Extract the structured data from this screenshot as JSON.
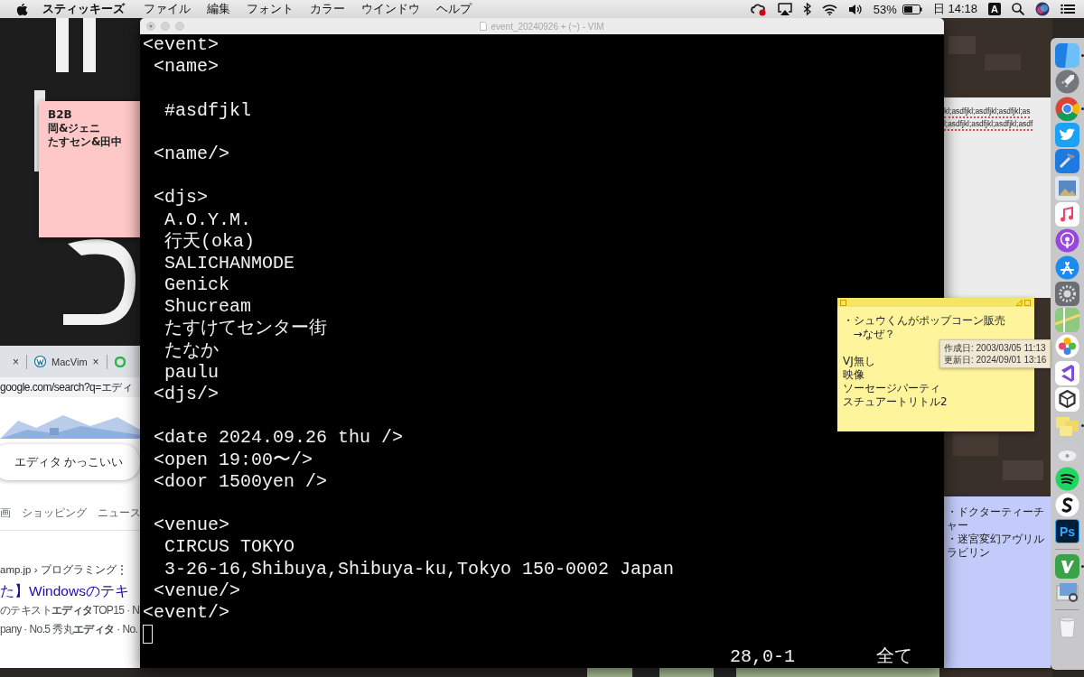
{
  "menu_bar": {
    "app_name": "スティッキーズ",
    "menus": [
      "ファイル",
      "編集",
      "フォント",
      "カラー",
      "ウインドウ",
      "ヘルプ"
    ],
    "battery": "53%",
    "clock": "日 14:18",
    "input_source": "A"
  },
  "stickies": [
    {
      "color": "#ffc8c8",
      "active": false,
      "lines": [
        {
          "text": "B2B"
        },
        {
          "text": "岡&ジェニ"
        },
        {
          "text": "たすセン&田中"
        }
      ]
    },
    {
      "color": "#fef49c",
      "active": true,
      "lines": [
        {
          "text": "・シュウくんがポップコーン販売"
        },
        {
          "text": "   →なぜ？"
        },
        {
          "kind": "blank"
        },
        {
          "text": "VJ無し"
        },
        {
          "text": "映像"
        },
        {
          "text": "ソーセージパーティ"
        },
        {
          "text": "スチュアートリトル2"
        }
      ]
    },
    {
      "color": "#c3cbfa",
      "active": false,
      "lines": [
        {
          "text": "・ドクターティーチャー"
        },
        {
          "text": "・迷宮変幻アヴリルラビリン"
        }
      ]
    }
  ],
  "sticky_tooltip": [
    "作成日: 2003/03/05 11:13",
    "更新日: 2024/09/01 13:16"
  ],
  "text_window": {
    "lines": [
      "kl;asdfjkl;asdfjkl;asdfjkl;as",
      "l;asdfjkl;asdfjkl;asdfjkl;asdf"
    ]
  },
  "browser": {
    "tabs": [
      {
        "kind": "close-only",
        "close": "×"
      },
      {
        "kind": "page",
        "title": "MacVim",
        "close": "×"
      },
      {
        "kind": "icon-only"
      }
    ],
    "address": "google.com/search?q=エディ",
    "query": "エディタ かっこいい",
    "search_tabs": [
      "画",
      "ショッピング",
      "ニュース"
    ],
    "result": {
      "breadcrumb": "amp.jp › プログラミング",
      "menu": "⋮",
      "title": "た】Windowsのテキ",
      "snippet": [
        "のテキスト**エディタ**TOP15 · N",
        "pany · No.5 秀丸**エディタ** · No."
      ]
    }
  },
  "vim": {
    "title": "event_20240926 + (~) - VIM",
    "lines": [
      {
        "text": "<event>"
      },
      {
        "text": " <name>"
      },
      {
        "kind": "blank"
      },
      {
        "text": "  #asdfjkl"
      },
      {
        "kind": "blank"
      },
      {
        "text": " <name/>"
      },
      {
        "kind": "blank"
      },
      {
        "text": " <djs>"
      },
      {
        "text": "  A.O.Y.M."
      },
      {
        "text": "  行天(oka)"
      },
      {
        "text": "  SALICHANMODE"
      },
      {
        "text": "  Genick"
      },
      {
        "text": "  Shucream"
      },
      {
        "text": "  たすけてセンター街"
      },
      {
        "text": "  たなか"
      },
      {
        "text": "  paulu"
      },
      {
        "text": " <djs/>"
      },
      {
        "kind": "blank"
      },
      {
        "text": " <date 2024.09.26 thu />"
      },
      {
        "text": " <open 19:00〜/>"
      },
      {
        "text": " <door 1500yen />"
      },
      {
        "kind": "blank"
      },
      {
        "text": " <venue>"
      },
      {
        "text": "  CIRCUS TOKYO"
      },
      {
        "text": "  3-26-16,Shibuya,Shibuya-ku,Tokyo 150-0002 Japan"
      },
      {
        "text": " <venue/>"
      },
      {
        "text": "<event/>"
      }
    ],
    "position": "28,0-1",
    "scroll": "全て"
  },
  "dock": {
    "items": [
      {
        "kind": "app",
        "running": true
      },
      {
        "kind": "app",
        "running": false
      },
      {
        "kind": "app",
        "running": true
      },
      {
        "kind": "app",
        "running": false
      },
      {
        "kind": "app",
        "running": false
      },
      {
        "kind": "app",
        "running": false
      },
      {
        "kind": "app",
        "running": false
      },
      {
        "kind": "app",
        "running": false
      },
      {
        "kind": "app",
        "running": false
      },
      {
        "kind": "app",
        "running": false
      },
      {
        "kind": "app",
        "running": false
      },
      {
        "kind": "app",
        "running": false
      },
      {
        "kind": "app",
        "running": false
      },
      {
        "kind": "app",
        "running": false
      },
      {
        "kind": "app",
        "running": true
      },
      {
        "kind": "app",
        "running": false
      },
      {
        "kind": "app",
        "running": false
      },
      {
        "kind": "app",
        "running": false
      },
      {
        "kind": "app",
        "running": false,
        "label": "Ps"
      },
      {
        "kind": "divider"
      },
      {
        "kind": "app",
        "running": true
      },
      {
        "kind": "app",
        "running": false
      },
      {
        "kind": "divider"
      },
      {
        "kind": "app",
        "running": false
      }
    ]
  }
}
